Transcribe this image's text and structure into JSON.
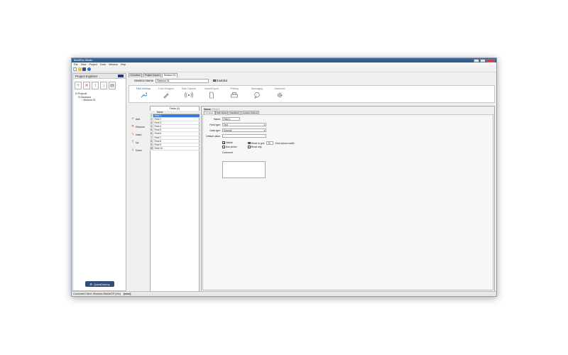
{
  "window": {
    "title": "BuildPlus Studio"
  },
  "menu": [
    "File",
    "View",
    "Project",
    "Tools",
    "Window",
    "Help"
  ],
  "explorer": {
    "title": "Project Explorer",
    "tree": {
      "project": "Project1",
      "sessions": "Sessions",
      "session": "Session 01"
    },
    "deploy_label": "QuickDeploy"
  },
  "doc_tabs": [
    "Overview",
    "Project Import",
    "Session 01"
  ],
  "session": {
    "name_label": "Session Name",
    "name_value": "Session 01",
    "enabled_label": "Enabled"
  },
  "ribbon": [
    {
      "label": "Field Settings",
      "icon": "wrench-icon"
    },
    {
      "label": "Form Designer",
      "icon": "pen-icon"
    },
    {
      "label": "Data Capture",
      "icon": "radio-wave-icon"
    },
    {
      "label": "Import/Export",
      "icon": "document-icon"
    },
    {
      "label": "Printing",
      "icon": "printer-icon"
    },
    {
      "label": "Messaging",
      "icon": "chat-bubble-icon"
    },
    {
      "label": "Advanced",
      "icon": "gear-icon"
    }
  ],
  "fields_panel": {
    "title": "Fields (0)",
    "column": "Name",
    "rows": [
      "Field 1",
      "Field 2",
      "Field 3",
      "Field 4",
      "Field 5",
      "Field 6",
      "Field 7",
      "Field 8",
      "Field 9",
      "Field 10"
    ]
  },
  "actions": [
    {
      "label": "Add",
      "icon": "plus-icon",
      "color": "#2e9e3a"
    },
    {
      "label": "Remove",
      "icon": "x-icon",
      "color": "#d43a2f"
    },
    {
      "label": "Insert",
      "icon": "insert-arrow-icon",
      "color": "#e0921a"
    },
    {
      "label": "Up",
      "icon": "arrow-up-icon",
      "color": "#2a4f8f"
    },
    {
      "label": "Down",
      "icon": "arrow-down-icon",
      "color": "#2a4f8f"
    }
  ],
  "detail": {
    "name_label": "Name:",
    "name_value": "Field 1",
    "tabs": [
      "Controls",
      "Max Rows",
      "Validation",
      "Lookup Options"
    ],
    "form": {
      "name_label": "Name:",
      "name_value": "Field 1",
      "field_type_label": "Field type:",
      "field_type_value": "Text",
      "data_type_label": "Data type:",
      "data_type_value": "General",
      "default_label": "Default value:",
      "default_value": "",
      "visible_label": "Visible",
      "show_grid_label": "Show in grid",
      "show_grid_width": "70",
      "grid_width_label": "Grid column width",
      "use_picker_label": "Use picker",
      "read_only_label": "Read only",
      "comment_label": "Comment"
    }
  },
  "status": {
    "text": "Connected Client: Windows Mobile/CE (Info)",
    "mode": "(none)"
  }
}
